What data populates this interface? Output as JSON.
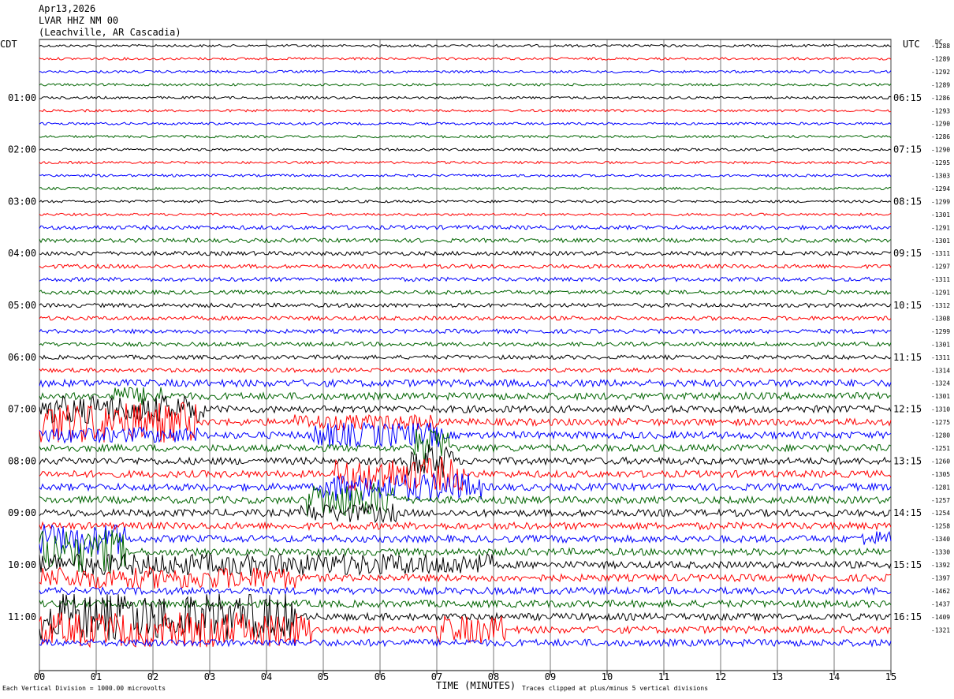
{
  "header": {
    "date": "Apr13,2026",
    "station": "LVAR HHZ NM 00",
    "location": "(Leachville, AR Cascadia)"
  },
  "labels": {
    "left_tz": "CDT",
    "right_tz": "UTC",
    "dc_header": "DC",
    "xaxis_title": "TIME (MINUTES)",
    "scale_note": "Each Vertical Division = 1000.00 microvolts",
    "clip_note": "Traces clipped at plus/minus 5 vertical divisions"
  },
  "colors": {
    "cycle": [
      "#000000",
      "#ff0000",
      "#0000ff",
      "#006400"
    ],
    "grid": "#000000"
  },
  "chart_data": {
    "type": "line",
    "description_free": true,
    "x_ticks": [
      "00",
      "01",
      "02",
      "03",
      "04",
      "05",
      "06",
      "07",
      "08",
      "09",
      "10",
      "11",
      "12",
      "13",
      "14",
      "15"
    ],
    "xlim": [
      0,
      15
    ],
    "left_hour_labels": [
      "01:00",
      "02:00",
      "03:00",
      "04:00",
      "05:00",
      "06:00",
      "07:00",
      "08:00",
      "09:00",
      "10:00",
      "11:00"
    ],
    "right_hour_labels": [
      "06:15",
      "07:15",
      "08:15",
      "09:15",
      "10:15",
      "11:15",
      "12:15",
      "13:15",
      "14:15",
      "15:15",
      "16:15"
    ],
    "dc_offsets": [
      -1288,
      -1289,
      -1292,
      -1289,
      -1286,
      -1293,
      -1290,
      -1286,
      -1290,
      -1295,
      -1303,
      -1294,
      -1299,
      -1301,
      -1291,
      -1301,
      -1311,
      -1297,
      -1311,
      -1291,
      -1312,
      -1308,
      -1299,
      -1301,
      -1311,
      -1314,
      -1324,
      -1301,
      -1310,
      -1275,
      -1280,
      -1251,
      -1260,
      -1305,
      -1281,
      -1257,
      -1254,
      -1258,
      -1340,
      -1330,
      -1392,
      -1397,
      -1462,
      -1437,
      -1409,
      -1321
    ],
    "trace_count": 47
  }
}
